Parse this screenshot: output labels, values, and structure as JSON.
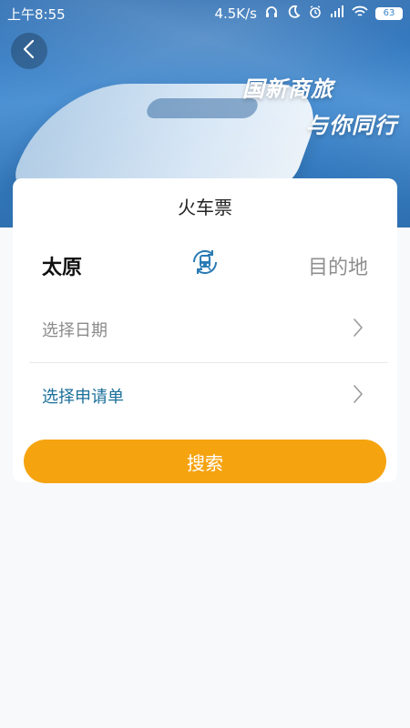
{
  "status_bar": {
    "time": "上午8:55",
    "net_speed": "4.5K/s",
    "battery": "63"
  },
  "banner": {
    "slogan_line1": "国新商旅",
    "slogan_line2": "与你同行"
  },
  "card": {
    "title": "火车票",
    "from_city": "太原",
    "to_city": "目的地",
    "date_label": "选择日期",
    "application_label": "选择申请单",
    "search_label": "搜索"
  },
  "colors": {
    "banner_blue": "#3a86cf",
    "accent_orange": "#f5a30f",
    "link_teal": "#1b6f9a"
  },
  "icons": {
    "back": "chevron-left-icon",
    "swap": "train-swap-icon",
    "chevron": "chevron-right-icon"
  }
}
